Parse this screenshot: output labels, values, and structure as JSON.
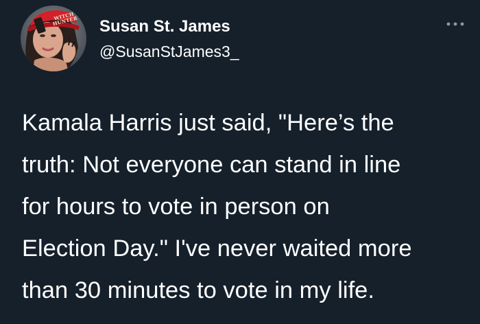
{
  "tweet": {
    "author": {
      "display_name": "Susan St. James",
      "handle": "@SusanStJames3_",
      "avatar_hat_text": "WITCH HUNTER"
    },
    "menu_icon": "more-horizontal-icon",
    "text": "Kamala Harris just said, \"Here’s the\ntruth: Not everyone can stand in line\nfor hours to vote in person on\nElection Day.\" I've never waited more\nthan 30 minutes to vote in my life."
  },
  "colors": {
    "background": "#15202b",
    "text": "#ffffff",
    "icon": "#8b98a5"
  }
}
